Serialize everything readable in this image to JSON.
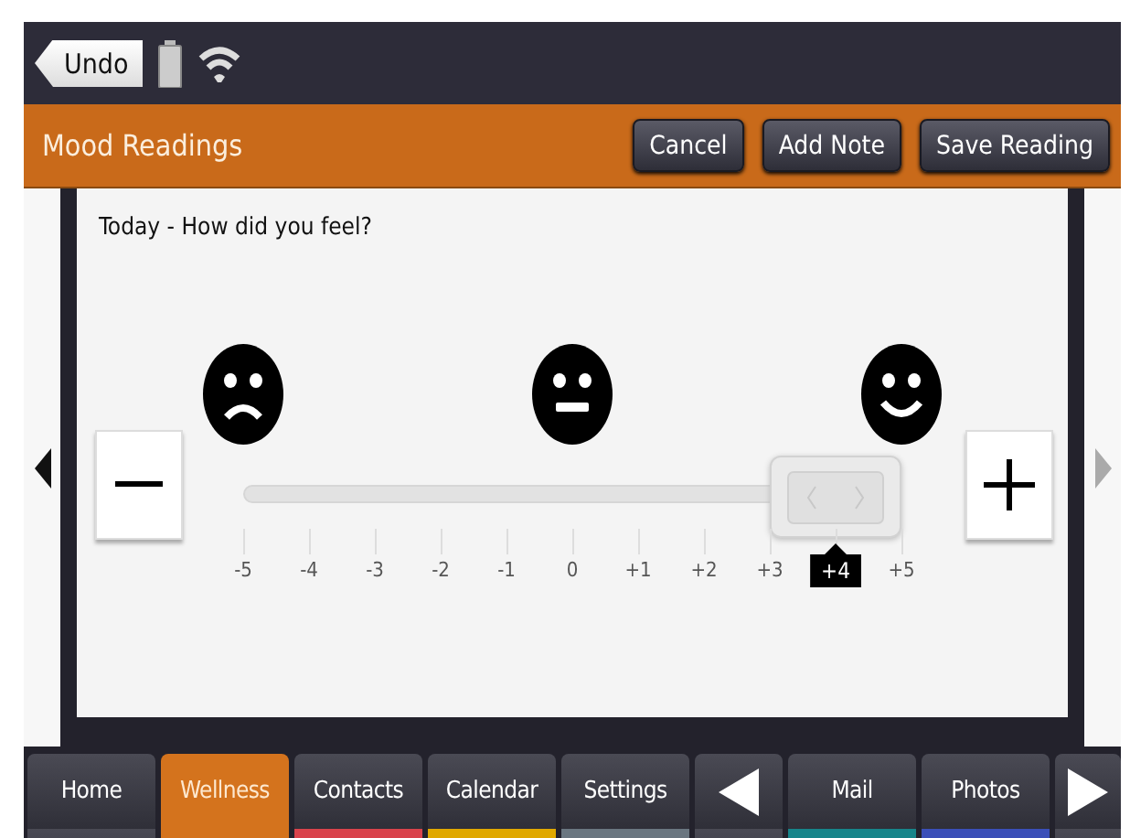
{
  "status_bar": {
    "back_button": "Undo"
  },
  "header": {
    "title": "Mood Readings",
    "buttons": [
      "Cancel",
      "Add Note",
      "Save Reading"
    ]
  },
  "pager": {
    "prev_disabled": false,
    "next_disabled": true
  },
  "mood": {
    "prompt": "Today - How did you feel?",
    "level": 0.9,
    "ticks": [
      "-5",
      "-4",
      "-3",
      "-2",
      "-1",
      "0",
      "+1",
      "+2",
      "+3",
      "+4",
      "+5"
    ]
  },
  "nav": {
    "tabs": [
      {
        "kind": "tab",
        "label": "Home",
        "selected": false
      },
      {
        "kind": "tab",
        "label": "Wellness",
        "selected": true
      },
      {
        "kind": "tab",
        "label": "Contacts",
        "selected": false,
        "color": "#d9434b"
      },
      {
        "kind": "tab",
        "label": "Calendar",
        "selected": false,
        "color": "#e0a800"
      },
      {
        "kind": "tab",
        "label": "Settings",
        "selected": false,
        "color": "#6a7680"
      },
      {
        "kind": "prev"
      },
      {
        "kind": "tab",
        "label": "Mail",
        "selected": false,
        "color": "#17858a"
      },
      {
        "kind": "tab",
        "label": "Photos",
        "selected": false,
        "color": "#3b4fb8"
      },
      {
        "kind": "next"
      }
    ]
  }
}
